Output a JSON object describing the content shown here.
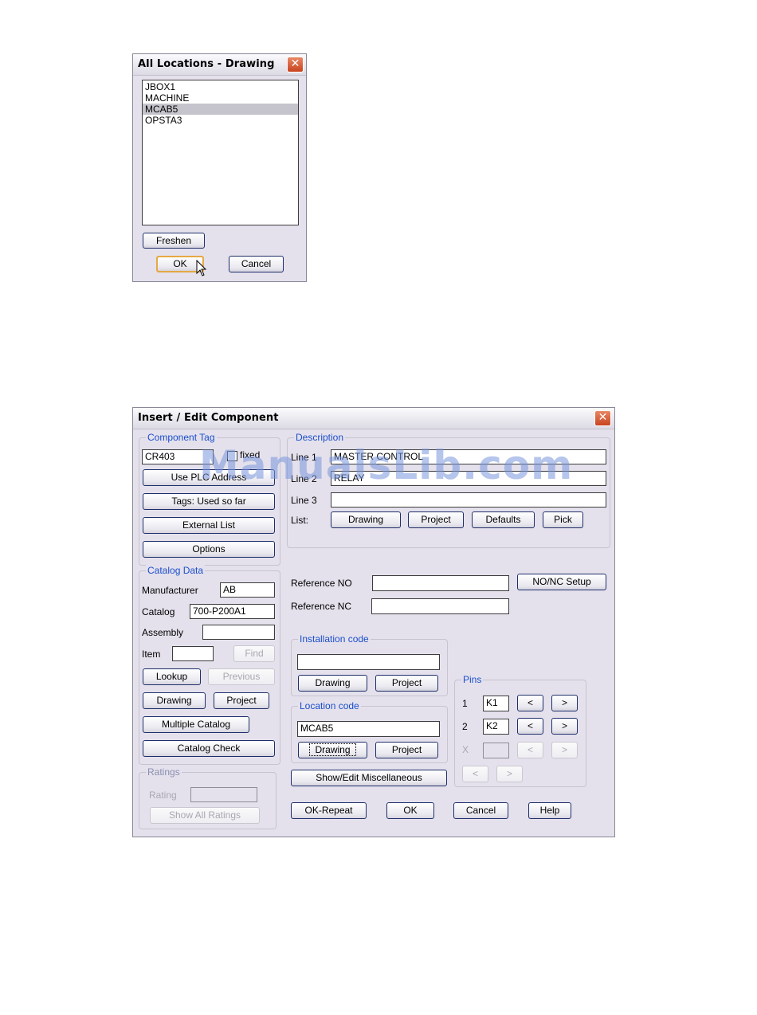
{
  "locations_dialog": {
    "title": "All Locations - Drawing",
    "close_glyph": "✕",
    "items": [
      "JBOX1",
      "MACHINE",
      "MCAB5",
      "OPSTA3"
    ],
    "selected_item": "MCAB5",
    "freshen_label": "Freshen",
    "ok_label": "OK",
    "cancel_label": "Cancel"
  },
  "component_dialog": {
    "title": "Insert / Edit Component",
    "close_glyph": "✕",
    "component_tag": {
      "label": "Component Tag",
      "value": "CR403",
      "fixed_label": "fixed",
      "use_plc_label": "Use PLC Address",
      "tags_used_label": "Tags: Used so far",
      "external_list_label": "External List",
      "options_label": "Options"
    },
    "catalog_data": {
      "label": "Catalog Data",
      "manufacturer_label": "Manufacturer",
      "manufacturer_value": "AB",
      "catalog_label": "Catalog",
      "catalog_value": "700-P200A1",
      "assembly_label": "Assembly",
      "assembly_value": "",
      "item_label": "Item",
      "item_value": "",
      "find_label": "Find",
      "lookup_label": "Lookup",
      "previous_label": "Previous",
      "drawing_label": "Drawing",
      "project_label": "Project",
      "multiple_catalog_label": "Multiple Catalog",
      "catalog_check_label": "Catalog Check"
    },
    "ratings": {
      "label": "Ratings",
      "rating_label": "Rating",
      "rating_value": "",
      "show_all_label": "Show All Ratings"
    },
    "description": {
      "label": "Description",
      "line1_label": "Line 1",
      "line1_value": "MASTER CONTROL",
      "line2_label": "Line 2",
      "line2_value": "RELAY",
      "line3_label": "Line 3",
      "line3_value": "",
      "list_label": "List:",
      "drawing_label": "Drawing",
      "project_label": "Project",
      "defaults_label": "Defaults",
      "pick_label": "Pick"
    },
    "reference": {
      "no_label": "Reference NO",
      "no_value": "",
      "nc_label": "Reference NC",
      "nc_value": "",
      "setup_label": "NO/NC Setup"
    },
    "installation_code": {
      "label": "Installation code",
      "value": "",
      "drawing_label": "Drawing",
      "project_label": "Project"
    },
    "location_code": {
      "label": "Location code",
      "value": "MCAB5",
      "drawing_label": "Drawing",
      "project_label": "Project"
    },
    "show_edit_misc_label": "Show/Edit Miscellaneous",
    "pins": {
      "label": "Pins",
      "rows": [
        {
          "num": "1",
          "value": "K1"
        },
        {
          "num": "2",
          "value": "K2"
        },
        {
          "num": "X",
          "value": ""
        }
      ],
      "prev_glyph": "<",
      "next_glyph": ">"
    },
    "ok_repeat_label": "OK-Repeat",
    "ok_label": "OK",
    "cancel_label": "Cancel",
    "help_label": "Help"
  },
  "watermark": "ManualsLib.com"
}
